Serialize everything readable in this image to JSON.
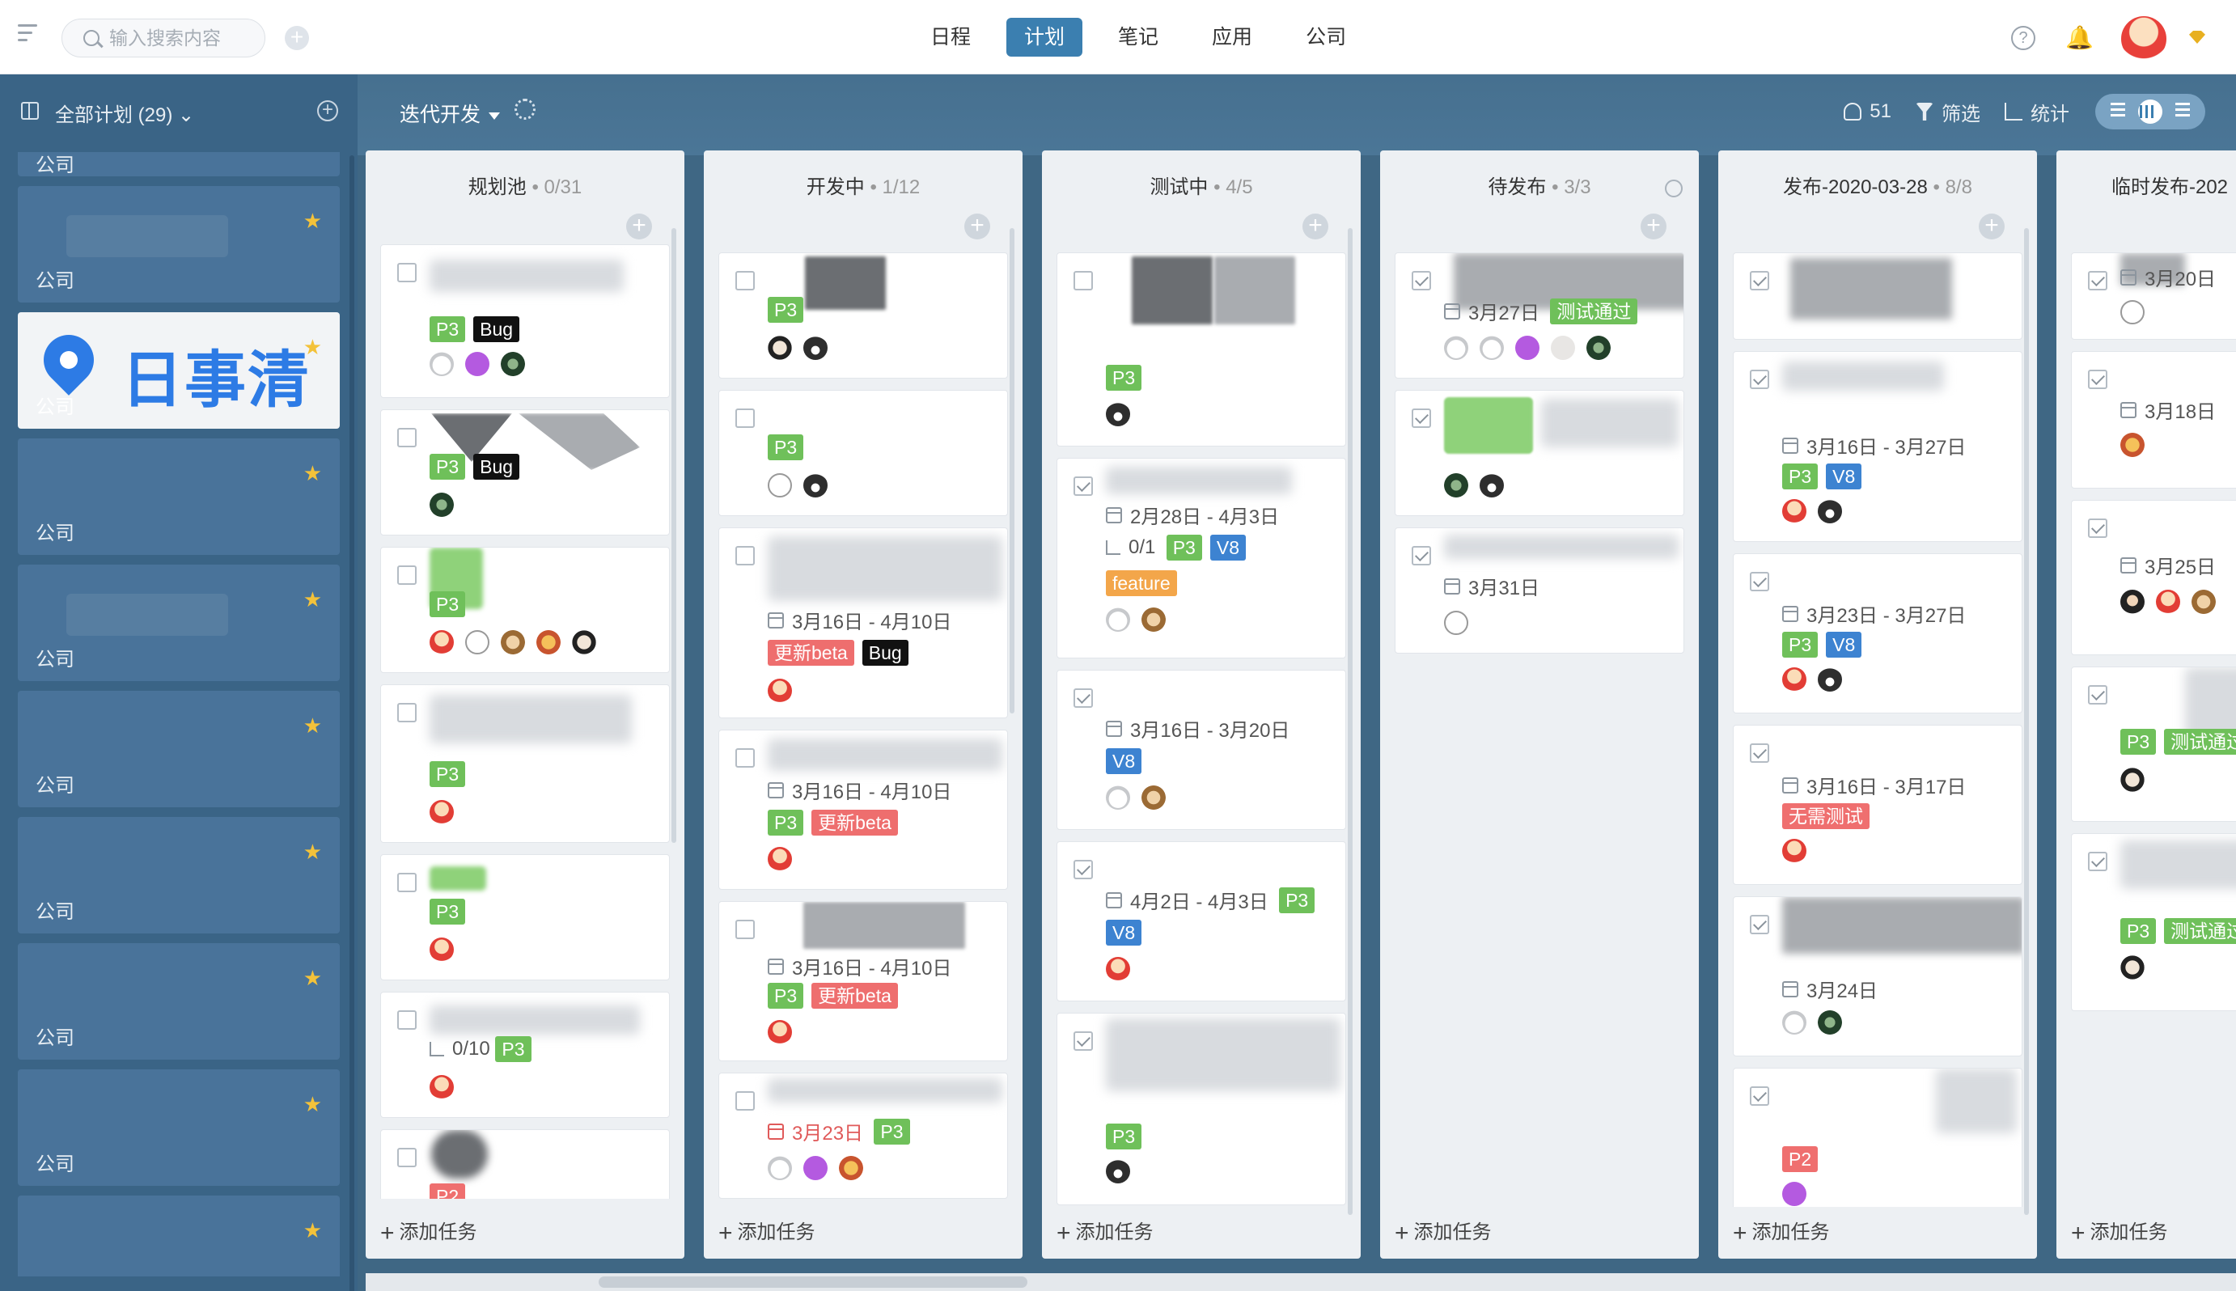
{
  "topbar": {
    "search_placeholder": "输入搜索内容",
    "nav": [
      {
        "label": "日程",
        "active": false
      },
      {
        "label": "计划",
        "active": true
      },
      {
        "label": "笔记",
        "active": false
      },
      {
        "label": "应用",
        "active": false
      },
      {
        "label": "公司",
        "active": false
      }
    ],
    "accent_color": "#3b7fb0"
  },
  "sidebar": {
    "title": "全部计划 (29)",
    "logo_text": "日事清",
    "cards": [
      {
        "label": "公司",
        "starred": false
      },
      {
        "label": "公司",
        "starred": true,
        "ghost_text": "小组"
      },
      {
        "label": "公司",
        "starred": true,
        "logo": true
      },
      {
        "label": "公司",
        "starred": true
      },
      {
        "label": "公司",
        "starred": true
      },
      {
        "label": "公司",
        "starred": true
      },
      {
        "label": "公司",
        "starred": true
      },
      {
        "label": "公司",
        "starred": true
      },
      {
        "label": "公司",
        "starred": true
      },
      {
        "label": "",
        "starred": true
      }
    ]
  },
  "toolbar": {
    "iteration": "迭代开发",
    "members_count": "51",
    "filter_label": "筛选",
    "stats_label": "统计"
  },
  "board": {
    "add_task_label": "添加任务",
    "columns": [
      {
        "name": "规划池",
        "count": "0/31"
      },
      {
        "name": "开发中",
        "count": "1/12"
      },
      {
        "name": "测试中",
        "count": "4/5"
      },
      {
        "name": "待发布",
        "count": "3/3"
      },
      {
        "name": "发布-2020-03-28",
        "count": "8/8"
      },
      {
        "name": "临时发布-202",
        "count": ""
      }
    ],
    "cards": {
      "c1": {
        "tags": [
          "P3",
          "Bug"
        ]
      },
      "c2": {
        "tags": [
          "P3",
          "Bug"
        ]
      },
      "c3": {
        "tags": [
          "P3"
        ]
      },
      "c4": {
        "tags": [
          "P3"
        ]
      },
      "c5": {
        "tags": [
          "P3"
        ]
      },
      "c6": {
        "subtasks": "0/10",
        "tags": [
          "P3"
        ]
      },
      "c7": {
        "tags": [
          "P2"
        ]
      },
      "d1": {
        "tags": [
          "P3"
        ]
      },
      "d2": {
        "tags": [
          "P3"
        ]
      },
      "d3": {
        "date": "3月16日 - 4月10日",
        "tags": [
          "更新beta",
          "Bug"
        ]
      },
      "d4": {
        "date": "3月16日 - 4月10日",
        "tags": [
          "P3",
          "更新beta"
        ]
      },
      "d5": {
        "date": "3月16日 - 4月10日",
        "tags": [
          "P3",
          "更新beta"
        ]
      },
      "d6": {
        "date": "3月23日",
        "tags": [
          "P3"
        ]
      },
      "t1": {
        "tags": [
          "P3"
        ]
      },
      "t2": {
        "date": "2月28日 - 4月3日",
        "subtasks": "0/1",
        "tags": [
          "P3",
          "V8",
          "feature"
        ]
      },
      "t3": {
        "date": "3月16日 - 3月20日",
        "tags": [
          "V8"
        ]
      },
      "t4": {
        "date": "4月2日 - 4月3日",
        "tags": [
          "P3",
          "V8"
        ]
      },
      "t5": {
        "tags": [
          "P3"
        ]
      },
      "p1": {
        "date": "3月27日",
        "tags": [
          "测试通过"
        ]
      },
      "p2": {},
      "p3": {
        "date": "3月31日"
      },
      "r1": {},
      "r2": {
        "date": "3月16日 - 3月27日",
        "tags": [
          "P3",
          "V8"
        ]
      },
      "r3": {
        "date": "3月23日 - 3月27日",
        "tags": [
          "P3",
          "V8"
        ]
      },
      "r4": {
        "date": "3月16日 - 3月17日",
        "tags": [
          "无需测试"
        ]
      },
      "r5": {
        "date": "3月24日"
      },
      "r6": {
        "tags": [
          "P2"
        ]
      },
      "x1": {
        "date": "3月20日"
      },
      "x2": {
        "date": "3月18日"
      },
      "x3": {
        "date": "3月25日"
      },
      "x4": {
        "tags": [
          "P3",
          "测试通过"
        ]
      },
      "x5": {
        "tags": [
          "P3",
          "测试通过"
        ]
      }
    }
  }
}
